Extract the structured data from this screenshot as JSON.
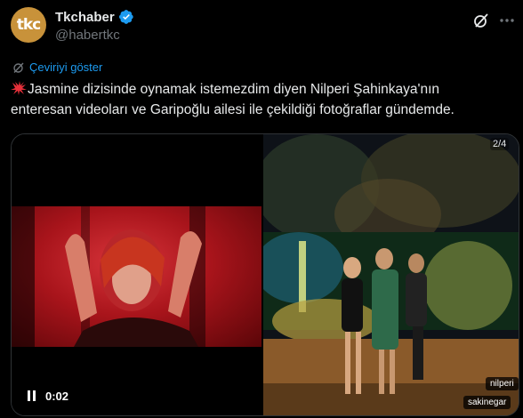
{
  "post": {
    "avatar_text": "tkc",
    "display_name": "Tkchaber",
    "handle": "@habertkc",
    "translate_label": "Çeviriyi göster",
    "text_line1": "Jasmine dizisinde oynamak istemezdim diyen Nilperi Şahinkaya'nın",
    "text_line2": "enteresan videoları ve Garipoğlu ailesi ile çekildiği fotoğraflar gündemde.",
    "brand_color": "#c8923a",
    "link_color": "#1d9bf0"
  },
  "media": {
    "video_time": "0:02",
    "photo_counter": "2/4",
    "tags": [
      "nilperi",
      "sakinegar"
    ]
  },
  "icons": {
    "verified": "verified-badge-icon",
    "grok": "grok-icon",
    "more": "more-options-icon",
    "translate": "translate-icon",
    "pause": "pause-icon",
    "emoji": "anger-symbol-emoji"
  }
}
